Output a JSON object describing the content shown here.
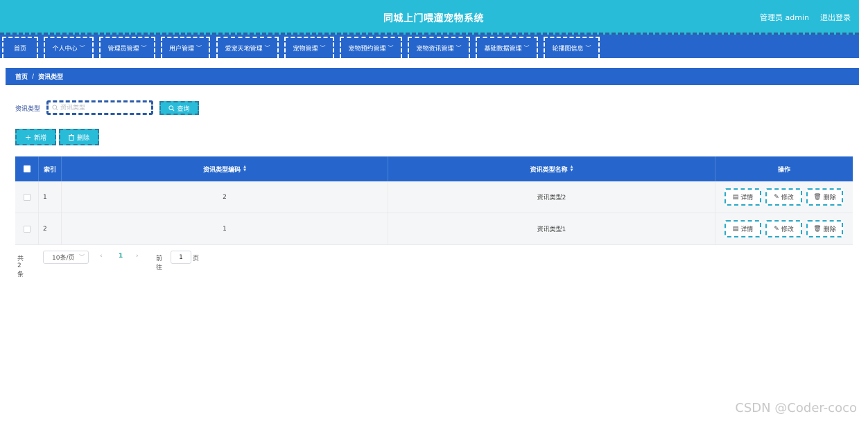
{
  "header": {
    "title": "同城上门喂遛宠物系统",
    "user": "管理员 admin",
    "logout": "退出登录"
  },
  "nav": [
    {
      "label": "首页",
      "dropdown": false
    },
    {
      "label": "个人中心",
      "dropdown": true
    },
    {
      "label": "管理员管理",
      "dropdown": true
    },
    {
      "label": "用户管理",
      "dropdown": true
    },
    {
      "label": "爱宠天地管理",
      "dropdown": true
    },
    {
      "label": "宠物管理",
      "dropdown": true
    },
    {
      "label": "宠物预约管理",
      "dropdown": true
    },
    {
      "label": "宠物资讯管理",
      "dropdown": true
    },
    {
      "label": "基础数据管理",
      "dropdown": true
    },
    {
      "label": "轮播图信息",
      "dropdown": true
    }
  ],
  "breadcrumb": {
    "home": "首页",
    "separator": "/",
    "current": "资讯类型"
  },
  "search": {
    "label": "资讯类型",
    "placeholder": "资讯类型",
    "value": "",
    "query_label": "查询"
  },
  "toolbar": {
    "add_label": "新增",
    "delete_label": "删除"
  },
  "table": {
    "headers": {
      "index": "索引",
      "code": "资讯类型编码",
      "name": "资讯类型名称",
      "actions": "操作"
    },
    "rows": [
      {
        "index": "1",
        "code": "2",
        "name": "资讯类型2"
      },
      {
        "index": "2",
        "code": "1",
        "name": "资讯类型1"
      }
    ],
    "row_actions": {
      "detail": "详情",
      "edit": "修改",
      "delete": "删除"
    }
  },
  "pagination": {
    "total": "共 2 条",
    "page_size": "10条/页",
    "current_page": "1",
    "goto_label": "前往",
    "goto_value": "1",
    "page_suffix": "页"
  },
  "watermark": "CSDN @Coder-coco",
  "colors": {
    "header": "#29bcd9",
    "nav": "#2666cc",
    "accent": "#29bcd9"
  }
}
